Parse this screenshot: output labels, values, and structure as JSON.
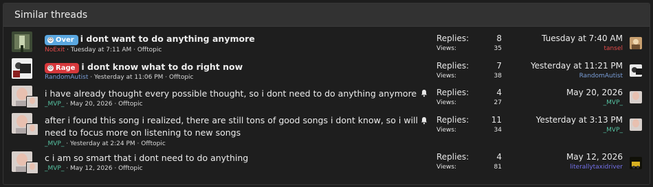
{
  "header": {
    "title": "Similar threads"
  },
  "labels": {
    "replies": "Replies:",
    "views": "Views:"
  },
  "threads": [
    {
      "prefix": "Over",
      "prefix_color": "#5aa7e0",
      "title": "i dont want to do anything anymore",
      "author": "NoExit",
      "author_color": "#e34b4b",
      "date": "Tuesday at 7:11 AM",
      "forum": "Offtopic",
      "replies": "8",
      "views": "35",
      "last_date": "Tuesday at 7:40 AM",
      "last_user": "tansel",
      "last_user_color": "#e34b4b"
    },
    {
      "prefix": "Rage",
      "prefix_color": "#d6383c",
      "title": "i dont know what to do right now",
      "author": "RandomAutist",
      "author_color": "#7a9ed8",
      "date": "Yesterday at 11:06 PM",
      "forum": "Offtopic",
      "replies": "7",
      "views": "38",
      "last_date": "Yesterday at 11:21 PM",
      "last_user": "RandomAutist",
      "last_user_color": "#7a9ed8"
    },
    {
      "title": "i have already thought every possible thought, so i dont need to do anything anymore",
      "author": "_MVP_",
      "author_color": "#56c3a2",
      "date": "May 20, 2026",
      "forum": "Offtopic",
      "replies": "4",
      "views": "27",
      "last_date": "May 20, 2026",
      "last_user": "_MVP_",
      "last_user_color": "#56c3a2"
    },
    {
      "title": "after i found this song i realized, there are still tons of good songs i dont know, so i will need to focus more on listening to new songs",
      "author": "_MVP_",
      "author_color": "#56c3a2",
      "date": "Yesterday at 2:24 PM",
      "forum": "Offtopic",
      "replies": "11",
      "views": "34",
      "last_date": "Yesterday at 3:13 PM",
      "last_user": "_MVP_",
      "last_user_color": "#56c3a2"
    },
    {
      "title": "c i am so smart that i dont need to do anything",
      "author": "_MVP_",
      "author_color": "#56c3a2",
      "date": "May 12, 2026",
      "forum": "Offtopic",
      "replies": "4",
      "views": "81",
      "last_date": "May 12, 2026",
      "last_user": "literallytaxidriver",
      "last_user_color": "#7370e8"
    }
  ],
  "colors": {
    "header_bg": "#323232",
    "panel_bg": "#1e1e1e",
    "text": "#ececec",
    "meta": "#d8d8d8"
  },
  "icons": {
    "subscribed": "bell-icon"
  }
}
